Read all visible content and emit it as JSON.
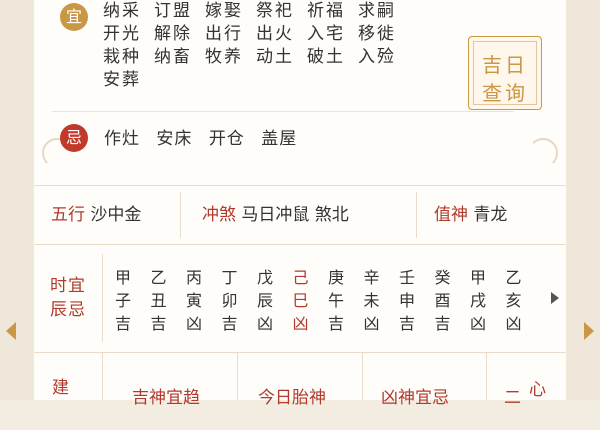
{
  "good": {
    "badge": "宜",
    "items": [
      "纳采",
      "订盟",
      "嫁娶",
      "祭祀",
      "祈福",
      "求嗣",
      "开光",
      "解除",
      "出行",
      "出火",
      "入宅",
      "移徙",
      "栽种",
      "纳畜",
      "牧养",
      "动土",
      "破土",
      "入殓",
      "安葬"
    ]
  },
  "lookup_button": {
    "line1": "吉日",
    "line2": "查询"
  },
  "bad": {
    "badge": "忌",
    "items": [
      "作灶",
      "安床",
      "开仓",
      "盖屋"
    ]
  },
  "wuxing": {
    "label": "五行",
    "value": "沙中金"
  },
  "chongsha": {
    "label": "冲煞",
    "value": "马日冲鼠 煞北"
  },
  "zhishen": {
    "label": "值神",
    "value": "青龙"
  },
  "hours": {
    "label_line1": "时宜",
    "label_line2": "辰忌",
    "items": [
      {
        "stem": "甲",
        "branch": "子",
        "luck": "吉"
      },
      {
        "stem": "乙",
        "branch": "丑",
        "luck": "吉"
      },
      {
        "stem": "丙",
        "branch": "寅",
        "luck": "凶"
      },
      {
        "stem": "丁",
        "branch": "卯",
        "luck": "吉"
      },
      {
        "stem": "戊",
        "branch": "辰",
        "luck": "凶"
      },
      {
        "stem": "己",
        "branch": "巳",
        "luck": "凶",
        "current": true
      },
      {
        "stem": "庚",
        "branch": "午",
        "luck": "吉"
      },
      {
        "stem": "辛",
        "branch": "未",
        "luck": "凶"
      },
      {
        "stem": "壬",
        "branch": "申",
        "luck": "吉"
      },
      {
        "stem": "癸",
        "branch": "酉",
        "luck": "吉"
      },
      {
        "stem": "甲",
        "branch": "戌",
        "luck": "凶"
      },
      {
        "stem": "乙",
        "branch": "亥",
        "luck": "凶"
      }
    ]
  },
  "bottom": {
    "jianchu_char": "建",
    "items": [
      "吉神宜趋",
      "今日胎神",
      "凶神宜忌"
    ],
    "right_top": "心",
    "right_left": "二"
  },
  "colors": {
    "gold": "#c99745",
    "red": "#b03a2e"
  },
  "icons": {
    "left_arrow": "triangle-left-icon",
    "right_arrow": "triangle-right-icon",
    "hours_next": "chevron-right-icon"
  }
}
